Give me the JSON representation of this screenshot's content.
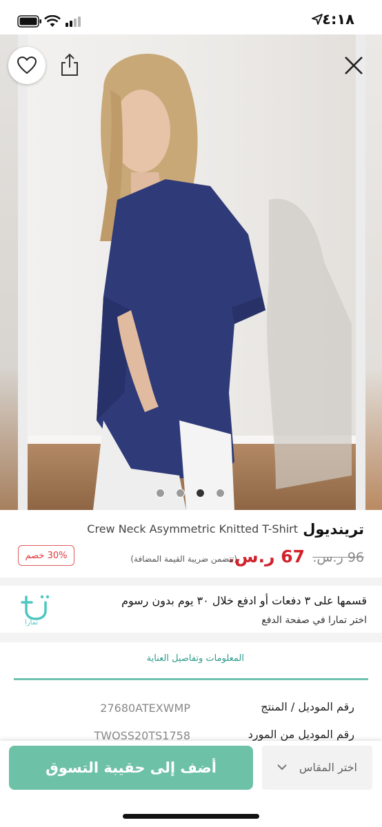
{
  "status_bar": {
    "time": "٤:١٨"
  },
  "gallery": {
    "image_count": 4,
    "active_index": 2
  },
  "product": {
    "brand": "ترينديول",
    "name": "Crew Neck Asymmetric Knitted T-Shirt",
    "old_price": "96 ر.س.",
    "new_price": "67 ر.س.",
    "vat_note": "(تتضمن ضريبة القيمة المضافة)",
    "discount": "30% خصم"
  },
  "tamara": {
    "title": "قسمها على ٣ دفعات أو ادفع خلال ٣٠ يوم بدون رسوم",
    "subtitle": "اختر تمارا في صفحة الدفع",
    "logo_text": "تمارا"
  },
  "details": {
    "tab_label": "المعلومات وتفاصيل العناية",
    "specs": [
      {
        "label": "رقم الموديل / المنتج",
        "value": "27680ATEXWMP"
      },
      {
        "label": "رقم الموديل من المورد",
        "value": "TWOSS20TS1758"
      }
    ]
  },
  "bottom_bar": {
    "add_to_bag": "أضف إلى حقيبة التسوق",
    "size_select": "اختر المقاس"
  },
  "colors": {
    "accent": "#6dc1a7",
    "price_red": "#d1212a",
    "tamara": "#4cc6c0",
    "shirt": "#2f3a78"
  }
}
